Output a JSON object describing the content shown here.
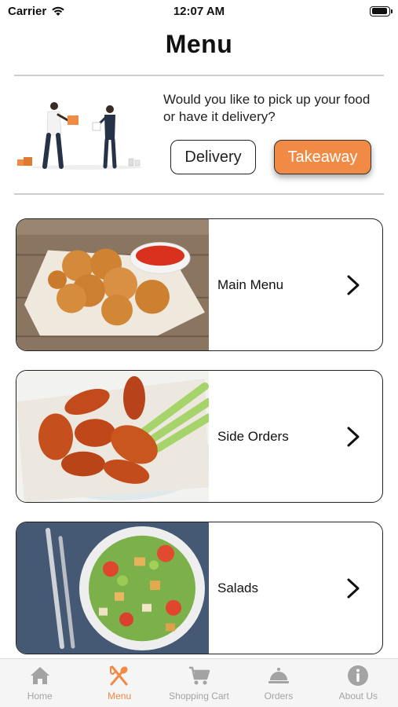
{
  "status": {
    "carrier": "Carrier",
    "time": "12:07 AM",
    "battery_level": 0.95
  },
  "page": {
    "title": "Menu"
  },
  "order_type": {
    "question": "Would you like to pick up your food or have it delivery?",
    "delivery_label": "Delivery",
    "takeaway_label": "Takeaway",
    "selected": "Takeaway"
  },
  "categories": [
    {
      "label": "Main Menu",
      "image": "chicken-nuggets-image"
    },
    {
      "label": "Side Orders",
      "image": "chicken-wings-image"
    },
    {
      "label": "Salads",
      "image": "salad-image"
    }
  ],
  "tabs": [
    {
      "label": "Home",
      "icon": "home-icon"
    },
    {
      "label": "Menu",
      "icon": "fork-spoon-icon"
    },
    {
      "label": "Shopping Cart",
      "icon": "cart-icon"
    },
    {
      "label": "Orders",
      "icon": "cloche-icon"
    },
    {
      "label": "About Us",
      "icon": "info-icon"
    }
  ],
  "active_tab": "Menu",
  "colors": {
    "accent": "#f08a44",
    "inactive": "#a3a3a3"
  }
}
